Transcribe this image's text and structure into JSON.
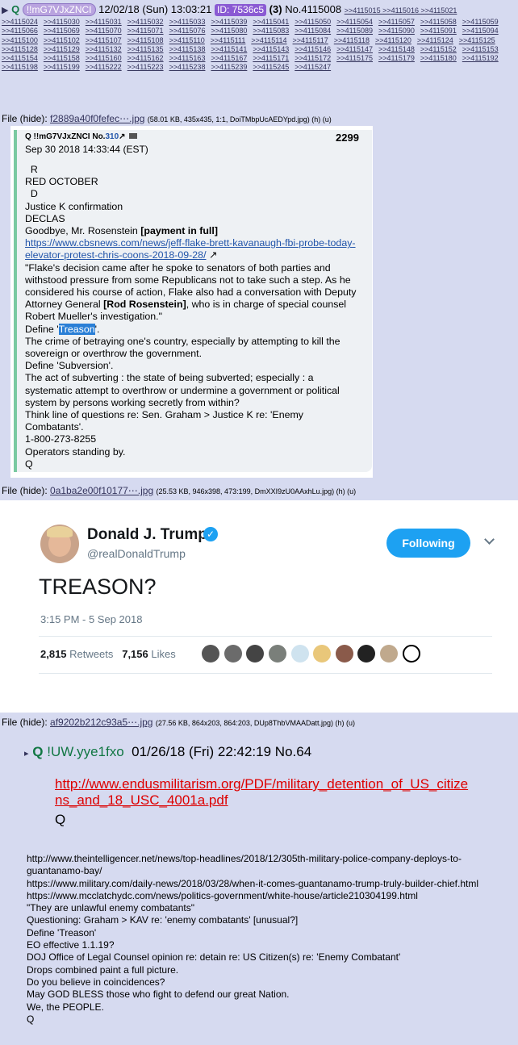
{
  "header": {
    "arrow": "▶",
    "name": "Q",
    "trip": "!!mG7VJxZNCI",
    "datetime": "12/02/18 (Sun) 13:03:21",
    "id_label": "ID: 7536c5",
    "reply_count": "(3)",
    "post_number": "No.4115008",
    "inline_backlinks": ">>4115015 >>4115016 >>4115021"
  },
  "backlinks": [
    ">>4115024",
    ">>4115030",
    ">>4115031",
    ">>4115032",
    ">>4115033",
    ">>4115039",
    ">>4115041",
    ">>4115050",
    ">>4115054",
    ">>4115057",
    ">>4115058",
    ">>4115059",
    ">>4115066",
    ">>4115069",
    ">>4115070",
    ">>4115071",
    ">>4115076",
    ">>4115080",
    ">>4115083",
    ">>4115084",
    ">>4115089",
    ">>4115090",
    ">>4115091",
    ">>4115094",
    ">>4115100",
    ">>4115102",
    ">>4115107",
    ">>4115108",
    ">>4115110",
    ">>4115111",
    ">>4115114",
    ">>4115117",
    ">>4115118",
    ">>4115120",
    ">>4115124",
    ">>4115125",
    ">>4115128",
    ">>4115129",
    ">>4115132",
    ">>4115135",
    ">>4115138",
    ">>4115141",
    ">>4115143",
    ">>4115146",
    ">>4115147",
    ">>4115148",
    ">>4115152",
    ">>4115153",
    ">>4115154",
    ">>4115158",
    ">>4115160",
    ">>4115162",
    ">>4115163",
    ">>4115167",
    ">>4115171",
    ">>4115172",
    ">>4115175",
    ">>4115179",
    ">>4115180",
    ">>4115192",
    ">>4115198",
    ">>4115199",
    ">>4115222",
    ">>4115223",
    ">>4115238",
    ">>4115239",
    ">>4115245",
    ">>4115247"
  ],
  "files": [
    {
      "prefix": "File (hide): ",
      "name": "f2889a40f0fefec⋯.jpg",
      "meta": "(58.01 KB, 435x435, 1:1, DoiTMbpUcAEDYpd.jpg) (h) (u)"
    },
    {
      "prefix": "File (hide): ",
      "name": "0a1ba2e00f10177⋯.jpg",
      "meta": "(25.53 KB, 946x398, 473:199, DmXXI9zU0AAxhLu.jpg) (h) (u)"
    },
    {
      "prefix": "File (hide): ",
      "name": "af9202b212c93a5⋯.jpg",
      "meta": "(27.56 KB, 864x203, 864:203, DUp8ThbVMAADatt.jpg) (h) (u)"
    }
  ],
  "drop1": {
    "header": "Q !!mG7VJxZNCI No.",
    "post_link": "310",
    "number": "2299",
    "date": "Sep 30 2018 14:33:44 (EST)",
    "lines": [
      "  R",
      "RED OCTOBER",
      "  D",
      "Justice K confirmation",
      "DECLAS"
    ],
    "goodbye_pre": "Goodbye, Mr. Rosenstein ",
    "goodbye_bold": "[payment in full]",
    "url": "https://www.cbsnews.com/news/jeff-flake-brett-kavanaugh-fbi-probe-today-elevator-protest-chris-coons-2018-09-28/",
    "quote_pre": "\"Flake's decision came after he spoke to senators of both parties and withstood pressure from some Republicans not to take such a step. As he considered his course of action, Flake also had a conversation with Deputy Attorney General ",
    "quote_bold": "[Rod Rosenstein]",
    "quote_post": ", who is in charge of special counsel Robert Mueller's investigation.\"",
    "define_pre": "Define '",
    "define_hl": "Treason",
    "define_post": "'.",
    "lines2": [
      "The crime of betraying one's country, especially by attempting to kill the sovereign or overthrow the government.",
      "Define 'Subversion'.",
      "The act of subverting : the state of being subverted; especially : a systematic attempt to overthrow or undermine a government or political system by persons working secretly from within?",
      "Think line of questions re: Sen. Graham > Justice K re: 'Enemy Combatants'.",
      "1-800-273-8255",
      "Operators standing by.",
      "Q"
    ]
  },
  "tweet": {
    "name": "Donald J. Trump",
    "handle": "@realDonaldTrump",
    "follow_label": "Following",
    "text": "TREASON?",
    "time": "3:15 PM - 5 Sep 2018",
    "retweets": "2,815",
    "retweets_label": "Retweets",
    "likes": "7,156",
    "likes_label": "Likes"
  },
  "drop3": {
    "arrow": "▸",
    "name": "Q",
    "trip": "!UW.yye1fxo",
    "datetime": "01/26/18 (Fri) 22:42:19",
    "number": "No.64",
    "link": "http://www.endusmilitarism.org/PDF/military_detention_of_US_citizens_and_18_USC_4001a.pdf",
    "sig": "Q"
  },
  "drop4": {
    "lines": [
      "http://www.theintelligencer.net/news/top-headlines/2018/12/305th-military-police-company-deploys-to-guantanamo-bay/",
      "https://www.military.com/daily-news/2018/03/28/when-it-comes-guantanamo-trump-truly-builder-chief.html",
      "https://www.mcclatchydc.com/news/politics-government/white-house/article210304199.html",
      "\"They are unlawful enemy combatants\"",
      "Questioning: Graham > KAV re: 'enemy combatants' [unusual?]",
      "Define 'Treason'",
      "EO effective 1.1.19?",
      "DOJ Office of Legal Counsel opinion re: detain re: US Citizen(s) re: 'Enemy Combatant'",
      "Drops combined paint a full picture.",
      "Do you believe in coincidences?",
      "May GOD BLESS those who fight to defend our great Nation.",
      "We, the PEOPLE.",
      "Q"
    ]
  }
}
